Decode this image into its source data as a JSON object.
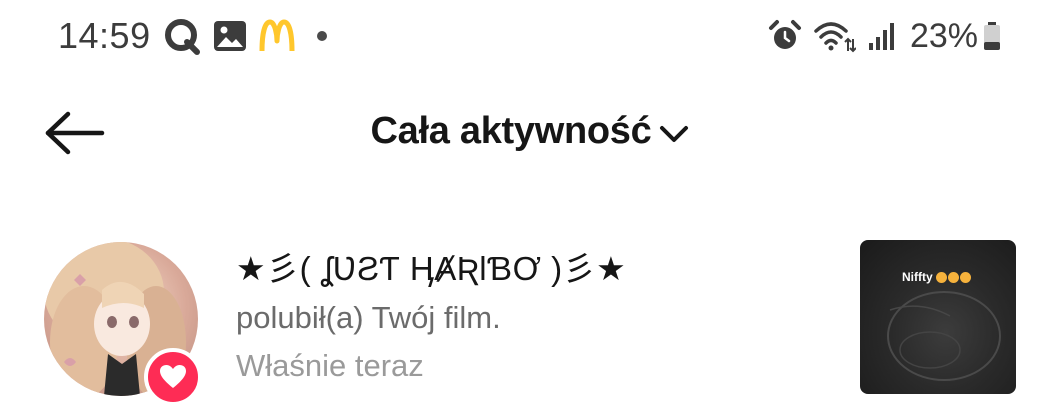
{
  "status_bar": {
    "time": "14:59",
    "battery": "23%",
    "icons": [
      "q-app-icon",
      "gallery-icon",
      "mcdonalds-icon",
      "dot-icon",
      "alarm-icon",
      "wifi-icon",
      "signal-icon",
      "battery-icon"
    ],
    "brand_logo_text": "M"
  },
  "header": {
    "title": "Cała aktywność",
    "back_icon": "arrow-left-icon",
    "dropdown_icon": "chevron-down-icon"
  },
  "notification": {
    "username": "★彡( ʆƲƧƬ ӉȺƦƖƁƠ )彡★",
    "action": "polubił(a) Twój film.",
    "time": "Właśnie teraz",
    "badge_icon": "heart-icon",
    "thumbnail_caption": "Niffty"
  },
  "colors": {
    "accent": "#fe2c55",
    "text_primary": "#161616",
    "text_secondary": "#6b6b6b",
    "text_tertiary": "#9a9a9a",
    "mcdonalds_yellow": "#ffc72c"
  }
}
